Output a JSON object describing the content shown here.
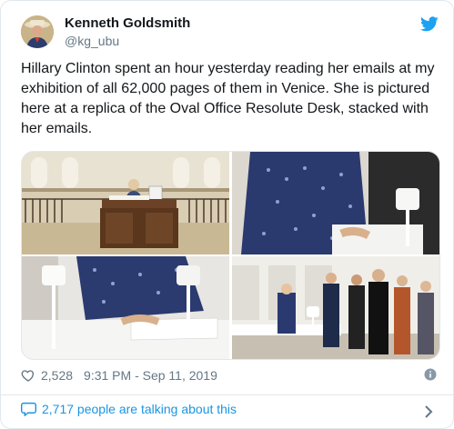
{
  "author": {
    "name": "Kenneth Goldsmith",
    "handle": "@kg_ubu"
  },
  "tweet": {
    "text": "Hillary Clinton spent an hour yesterday reading her emails at my exhibition of all 62,000 pages of them in Venice. She is pictured here at a replica of the Oval Office Resolute Desk, stacked with her emails."
  },
  "media": {
    "count": 4,
    "photos": [
      "desk-wide-shot",
      "reading-closeup",
      "pages-and-lamp",
      "gallery-visitors"
    ]
  },
  "stats": {
    "likes": "2,528",
    "timestamp": "9:31 PM - Sep 11, 2019"
  },
  "footer": {
    "talking": "2,717 people are talking about this"
  },
  "colors": {
    "text": "#14171a",
    "muted": "#657786",
    "accent": "#1b95e0",
    "twitter_blue": "#1da1f2",
    "border": "#e1e8ed"
  },
  "icons": {
    "brand": "twitter-bird-icon",
    "like": "heart-icon",
    "info": "info-icon",
    "reply": "speech-bubble-icon",
    "more": "chevron-right-icon"
  }
}
